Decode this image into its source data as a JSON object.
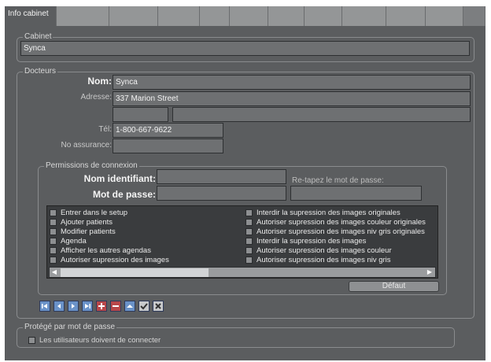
{
  "tabs": [
    {
      "label": "Info cabinet"
    },
    {
      "label": ""
    },
    {
      "label": ""
    },
    {
      "label": ""
    },
    {
      "label": ""
    },
    {
      "label": ""
    },
    {
      "label": ""
    },
    {
      "label": ""
    },
    {
      "label": ""
    },
    {
      "label": ""
    },
    {
      "label": ""
    },
    {
      "label": ""
    }
  ],
  "cabinet": {
    "legend": "Cabinet",
    "value": "Synca"
  },
  "docteurs": {
    "legend": "Docteurs",
    "nom_label": "Nom:",
    "nom_value": "Synca",
    "adresse_label": "Adresse:",
    "adresse_value": "337 Marion Street",
    "tel_label": "Tél:",
    "tel_value": "1-800-667-9622",
    "assurance_label": "No assurance:",
    "assurance_value": ""
  },
  "permissions": {
    "legend": "Permissions de connexion",
    "identifiant_label": "Nom identifiant:",
    "identifiant_value": "",
    "password_label": "Mot de passe:",
    "password_value": "",
    "retype_label": "Re-tapez le mot de passe:",
    "retype_value": "",
    "left_items": [
      "Entrer dans le setup",
      "Ajouter patients",
      "Modifier patients",
      "Agenda",
      "Afficher les autres agendas",
      "Autoriser supression des images"
    ],
    "right_items": [
      "Interdir la supression des images originales",
      "Autoriser supression des images couleur originales",
      "Autoriser supression des images niv gris originales",
      "Interdir la supression des images",
      "Autoriser supression des images couleur",
      "Autoriser supression des images niv gris"
    ],
    "default_button": "Défaut"
  },
  "toolbar": {
    "icons": [
      "first-icon",
      "previous-icon",
      "next-icon",
      "last-icon",
      "add-icon",
      "delete-icon",
      "edit-icon",
      "confirm-icon",
      "cancel-icon"
    ]
  },
  "protege": {
    "legend": "Protégé par mot de passe",
    "checkbox_label": "Les utilisateurs doivent de connecter"
  }
}
